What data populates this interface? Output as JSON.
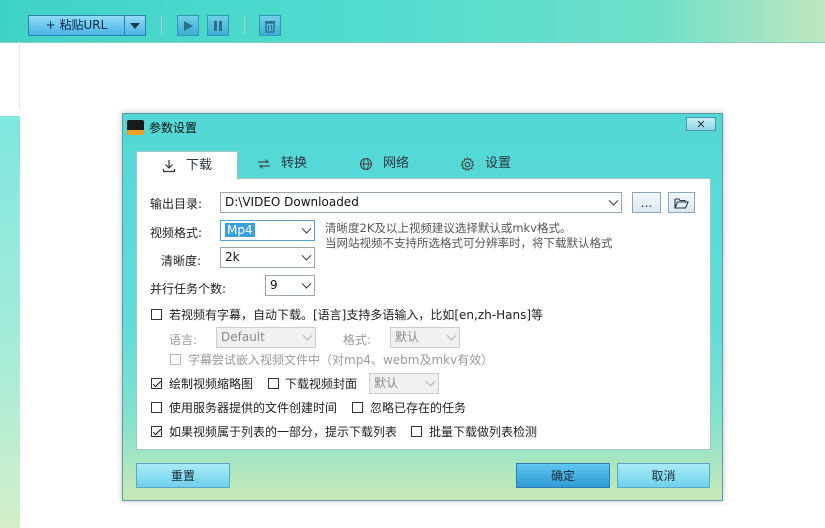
{
  "toolbar": {
    "paste_url_label": "+ 粘贴URL"
  },
  "dialog": {
    "title": "参数设置",
    "close_label": "✕",
    "tabs": [
      {
        "label": "下载",
        "icon": "download-icon",
        "active": true
      },
      {
        "label": "转换",
        "icon": "convert-icon",
        "active": false
      },
      {
        "label": "网络",
        "icon": "globe-icon",
        "active": false
      },
      {
        "label": "设置",
        "icon": "gear-icon",
        "active": false
      }
    ],
    "download": {
      "output_dir_label": "输出目录:",
      "output_dir_value": "D:\\VIDEO Downloaded",
      "browse_label": "...",
      "format_label": "视频格式:",
      "format_value": "Mp4",
      "format_hint_1": "清晰度2K及以上视频建议选择默认或mkv格式。",
      "format_hint_2": "当网站视频不支持所选格式可分辨率时，将下载默认格式",
      "quality_label": "清晰度:",
      "quality_value": "2k",
      "tasks_label": "并行任务个数:",
      "tasks_value": "9",
      "subtitle_check": "若视频有字幕，自动下载。[语言]支持多语输入，比如[en,zh-Hans]等",
      "subtitle_checked": false,
      "lang_label": "语言:",
      "lang_value": "Default",
      "sub_format_label": "格式:",
      "sub_format_value": "默认",
      "embed_check": "字幕尝试嵌入视频文件中（对mp4、webm及mkv有效）",
      "embed_checked": false,
      "thumb_check": "绘制视频缩略图",
      "thumb_checked": true,
      "cover_check": "下载视频封面",
      "cover_checked": false,
      "cover_value": "默认",
      "server_time_check": "使用服务器提供的文件创建时间",
      "server_time_checked": false,
      "ignore_existing_check": "忽略已存在的任务",
      "ignore_existing_checked": false,
      "playlist_check": "如果视频属于列表的一部分，提示下载列表",
      "playlist_checked": true,
      "batch_check": "批量下载做列表检测",
      "batch_checked": false
    },
    "buttons": {
      "reset": "重置",
      "ok": "确定",
      "cancel": "取消"
    }
  }
}
